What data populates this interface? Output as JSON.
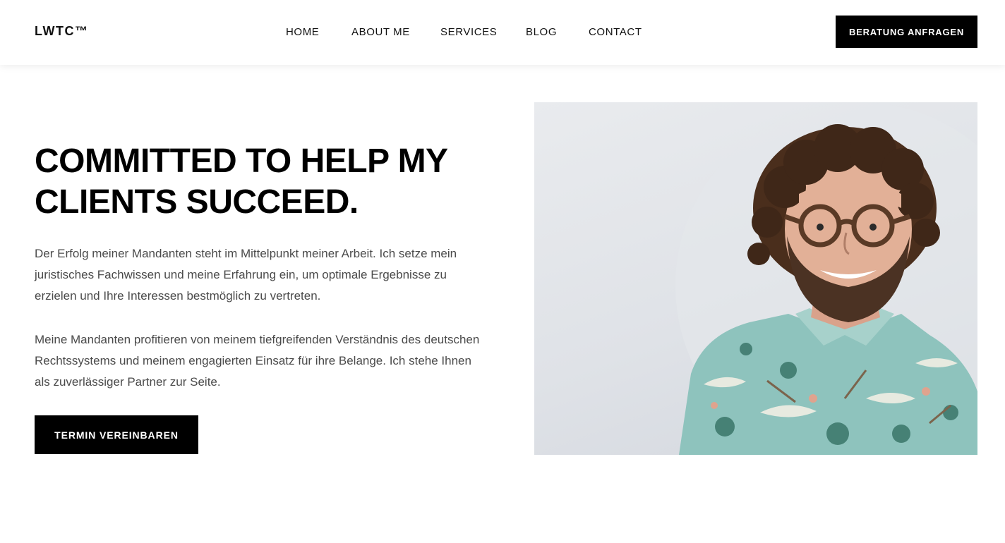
{
  "header": {
    "logo": "LWTC™",
    "nav": [
      {
        "label": "HOME"
      },
      {
        "label": "ABOUT ME"
      },
      {
        "label": "SERVICES"
      },
      {
        "label": "BLOG"
      },
      {
        "label": "CONTACT"
      }
    ],
    "cta_label": "BERATUNG ANFRAGEN"
  },
  "hero": {
    "title_line1": "COMMITTED TO HELP MY",
    "title_line2": "CLIENTS SUCCEED.",
    "paragraph1": "Der Erfolg meiner Mandanten steht im Mittelpunkt meiner Arbeit. Ich setze mein juristisches Fachwissen und meine Erfahrung ein, um optimale Ergebnisse zu erzielen und Ihre Interessen bestmöglich zu vertreten.",
    "paragraph2": "Meine Mandanten profitieren von meinem tiefgreifenden Verständnis des deutschen Rechtssystems und meinem engagierten Einsatz für ihre Belange. Ich stehe Ihnen als zuverlässiger Partner zur Seite.",
    "cta_label": "TERMIN VEREINBAREN"
  },
  "colors": {
    "background": "#ffffff",
    "text": "#111111",
    "body_text": "#4a4a4a",
    "button_bg": "#000000",
    "button_text": "#ffffff",
    "shirt": "#8ec3bd"
  }
}
